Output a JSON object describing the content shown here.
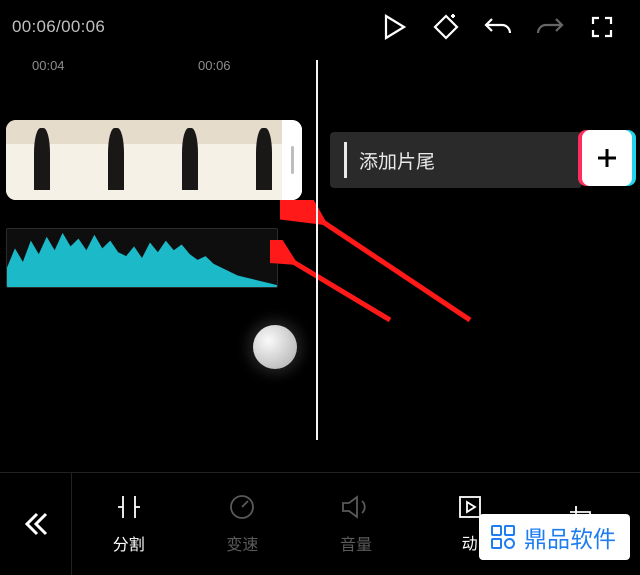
{
  "playback": {
    "time_display": "00:06/00:06"
  },
  "ruler": {
    "t1": "00:04",
    "t2": "00:06"
  },
  "clip": {
    "add_end_label": "添加片尾"
  },
  "tools": {
    "split": "分割",
    "speed": "变速",
    "volume": "音量",
    "anim": "动",
    "crop": ""
  },
  "watermark": {
    "label": "鼎品软件"
  },
  "colors": {
    "waveform": "#1cb9c8",
    "arrow": "#ff1919"
  },
  "chart_data": {
    "type": "area",
    "title": "audio waveform",
    "x_range": [
      0,
      6
    ],
    "y_range": [
      0,
      100
    ],
    "points": [
      [
        0,
        32
      ],
      [
        0.3,
        62
      ],
      [
        0.6,
        42
      ],
      [
        0.9,
        78
      ],
      [
        1.2,
        58
      ],
      [
        1.5,
        86
      ],
      [
        1.8,
        64
      ],
      [
        2.1,
        92
      ],
      [
        2.4,
        72
      ],
      [
        2.7,
        84
      ],
      [
        3.0,
        62
      ],
      [
        3.3,
        88
      ],
      [
        3.6,
        68
      ],
      [
        3.9,
        80
      ],
      [
        4.2,
        56
      ],
      [
        4.5,
        62
      ],
      [
        4.8,
        44
      ],
      [
        5.1,
        34
      ],
      [
        5.4,
        22
      ],
      [
        5.7,
        12
      ],
      [
        6.0,
        6
      ]
    ]
  }
}
